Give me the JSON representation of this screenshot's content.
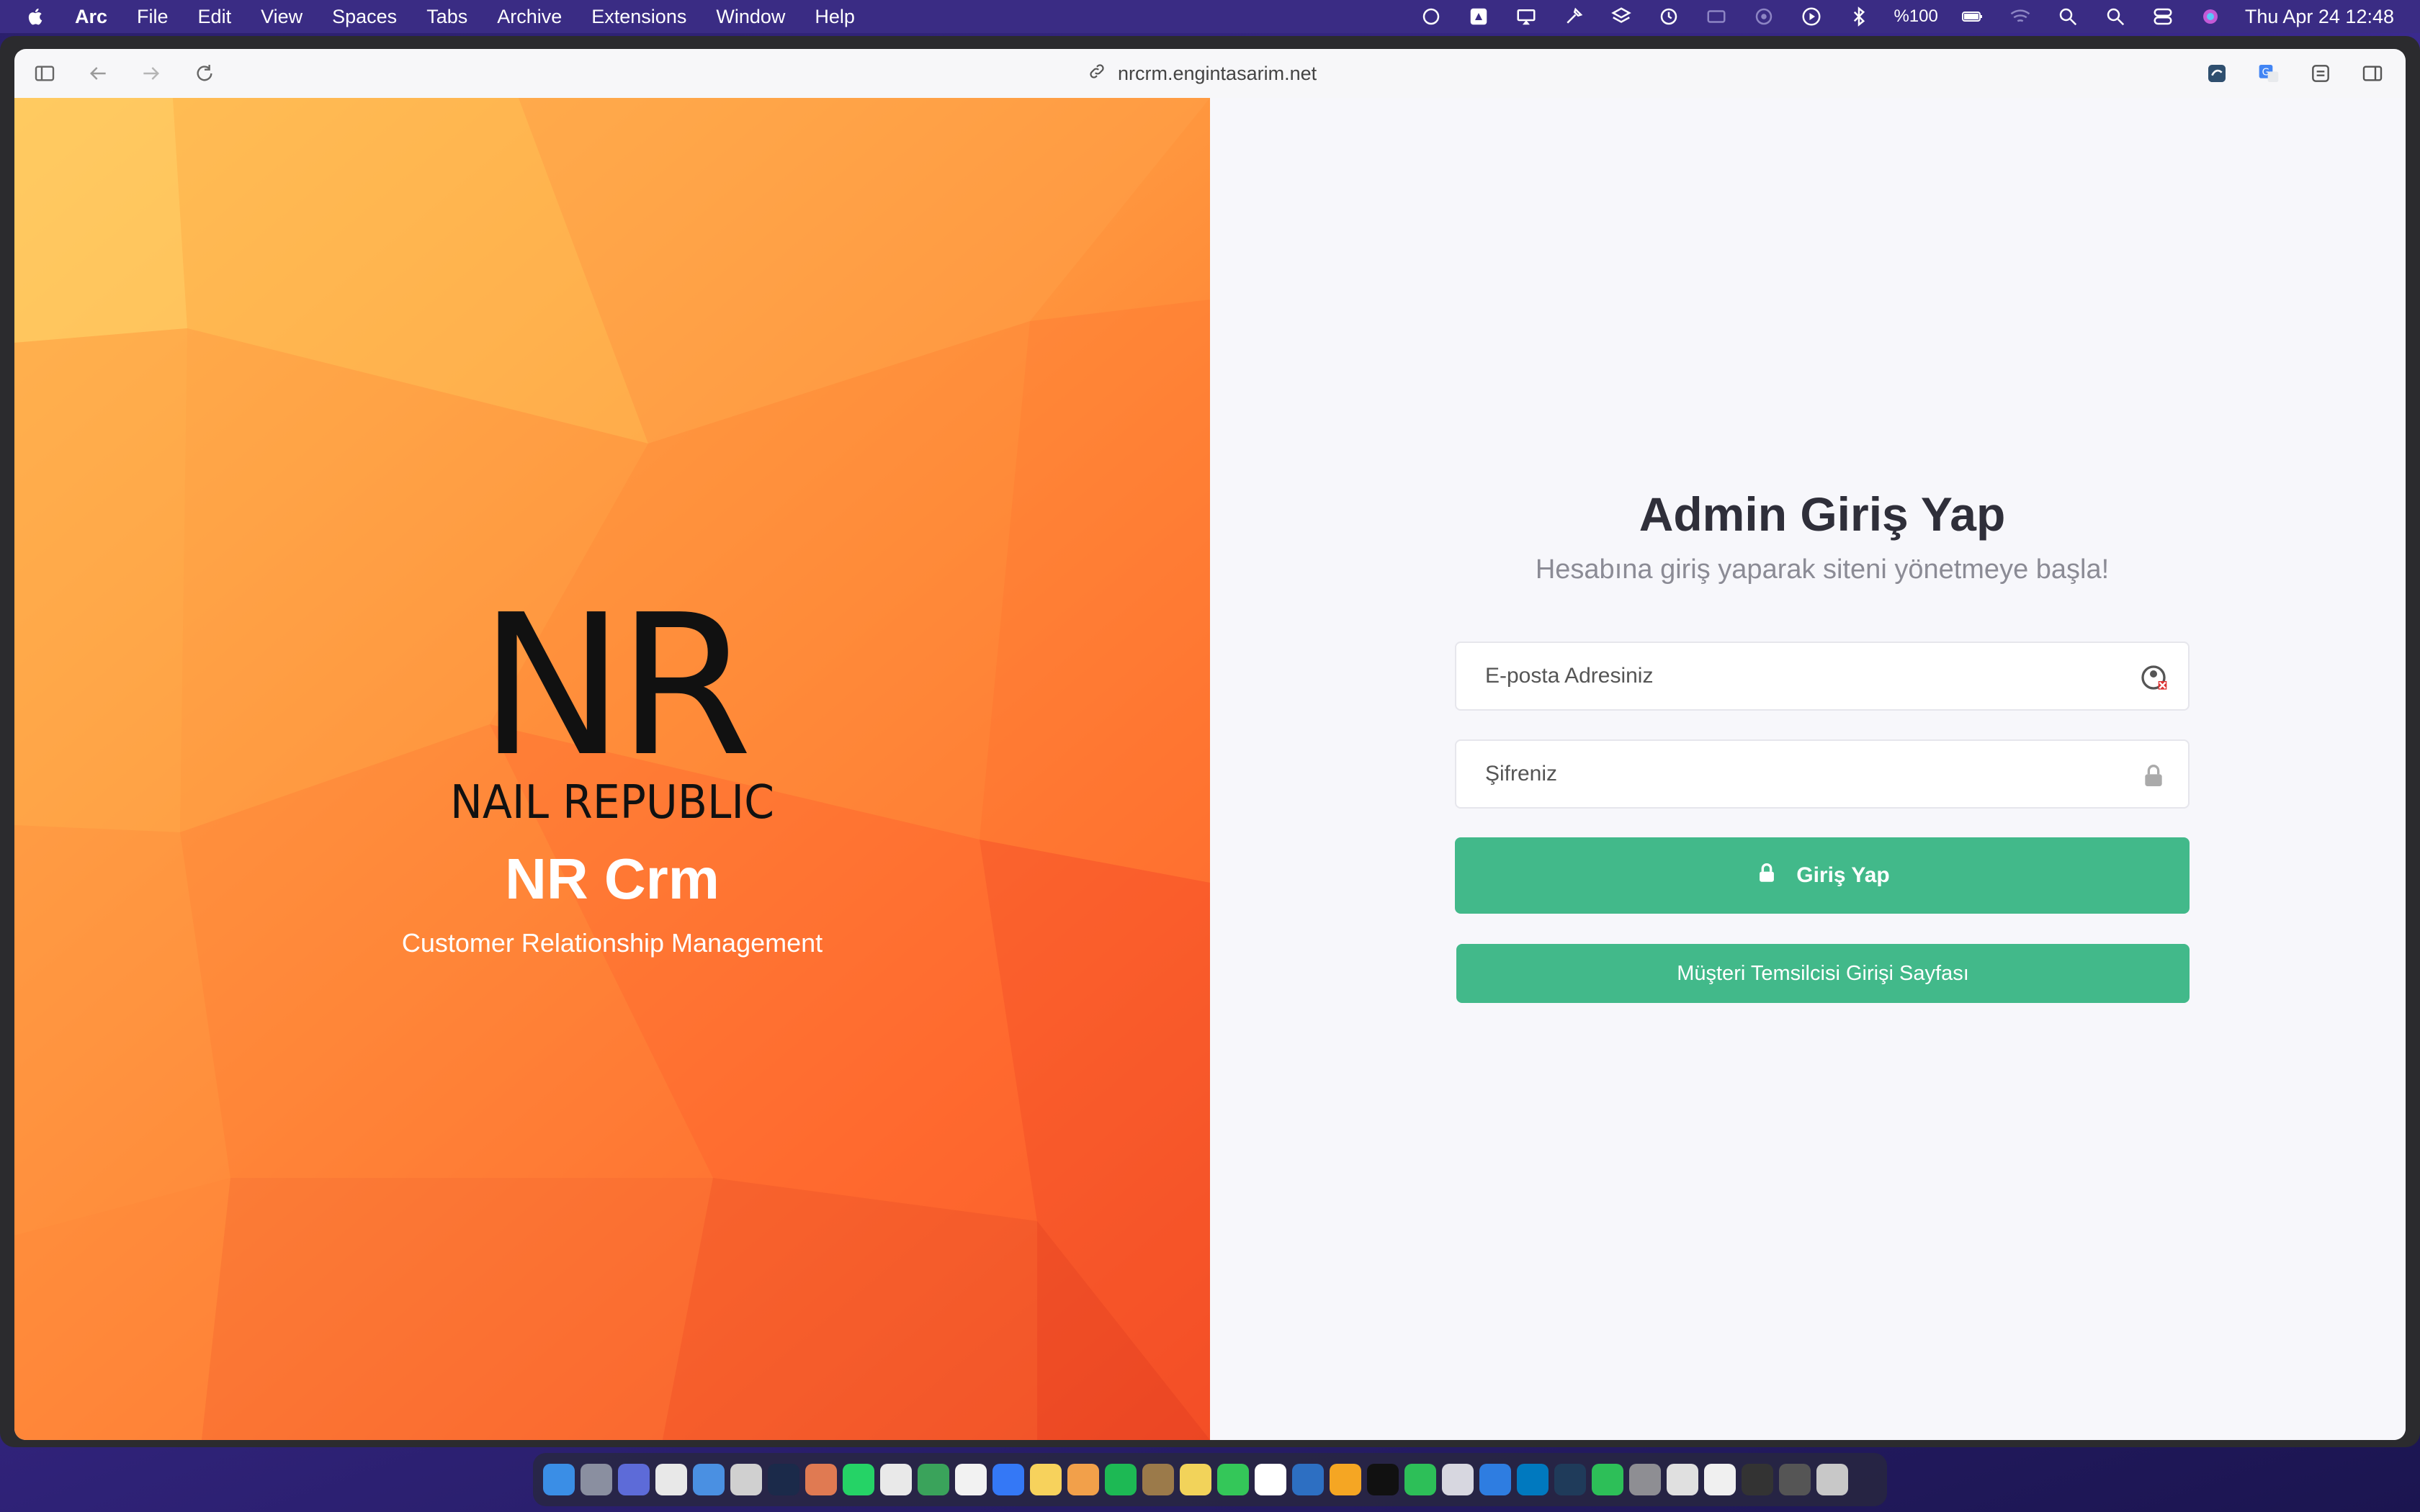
{
  "menubar": {
    "app_name": "Arc",
    "items": [
      "File",
      "Edit",
      "View",
      "Spaces",
      "Tabs",
      "Archive",
      "Extensions",
      "Window",
      "Help"
    ],
    "battery": "%100",
    "clock": "Thu Apr 24  12:48"
  },
  "browser": {
    "url": "nrcrm.engintasarim.net"
  },
  "brand": {
    "logo_letters": "NR",
    "logo_wordmark": "NAIL REPUBLIC",
    "title": "NR Crm",
    "subtitle": "Customer Relationship Management"
  },
  "login": {
    "title": "Admin Giriş Yap",
    "subtitle": "Hesabına giriş yaparak siteni yönetmeye başla!",
    "email_placeholder": "E-posta Adresiniz",
    "password_placeholder": "Şifreniz",
    "submit_label": "Giriş Yap",
    "rep_login_label": "Müşteri Temsilcisi Girişi Sayfası"
  },
  "colors": {
    "accent": "#42b98a",
    "menubar": "#3a2c84",
    "gradient_start": "#ffc65a",
    "gradient_end": "#f04823"
  },
  "dock": {
    "icons": [
      "finder-icon",
      "launchpad-icon",
      "preview-icon",
      "chrome-icon",
      "mail-icon",
      "chatgpt-icon",
      "app-icon",
      "claude-icon",
      "whatsapp-icon",
      "slack-icon",
      "app-icon",
      "reminders-icon",
      "maps-icon",
      "notes-icon",
      "photos-icon",
      "spotify-icon",
      "app-icon",
      "stickies-icon",
      "messages-icon",
      "calendar-icon",
      "dia-icon",
      "sublime-icon",
      "app-icon",
      "app-icon",
      "app-icon",
      "app-icon",
      "trello-icon",
      "app-icon",
      "facetime-icon",
      "settings-icon",
      "app-icon",
      "files-icon",
      "app-icon",
      "app-icon",
      "trash-icon"
    ]
  }
}
